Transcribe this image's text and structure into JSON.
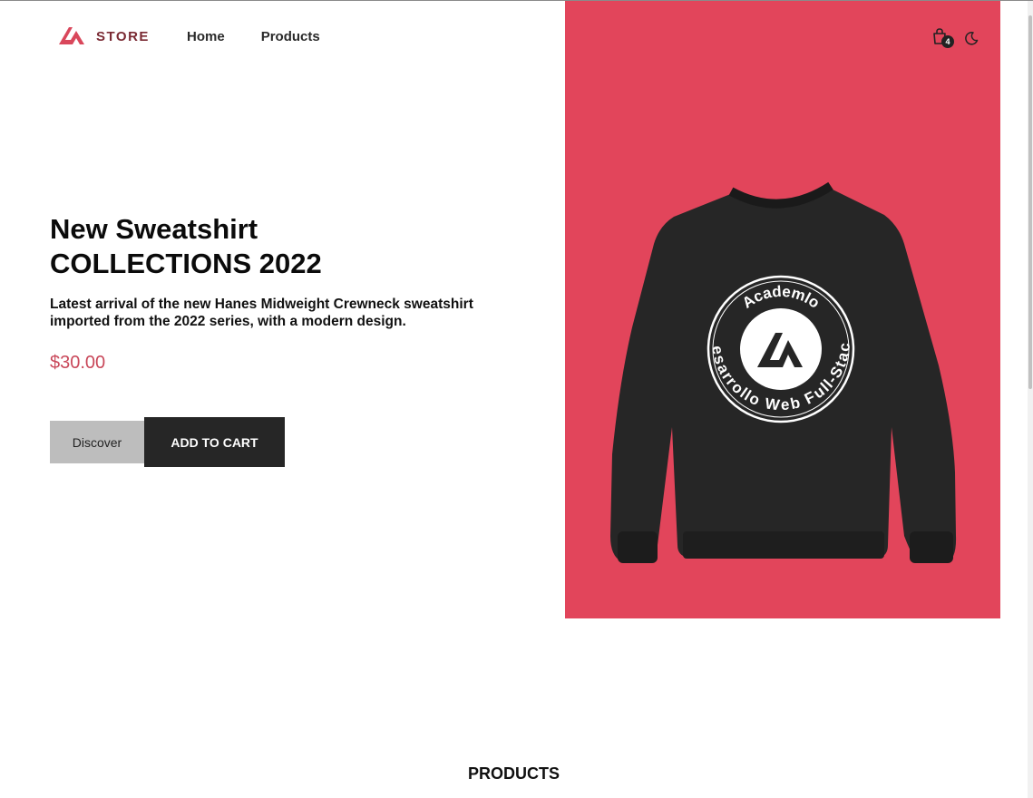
{
  "header": {
    "logo_text": "STORE",
    "nav": [
      {
        "label": "Home"
      },
      {
        "label": "Products"
      }
    ],
    "cart_count": "4",
    "icons": {
      "cart": "shopping-bag-icon",
      "theme": "moon-icon"
    }
  },
  "hero": {
    "title_line1": "New Sweatshirt",
    "title_line2": "COLLECTIONS 2022",
    "description": "Latest arrival of the new Hanes Midweight Crewneck sweatshirt imported from the 2022 series, with a modern design.",
    "price": "$30.00",
    "discover_label": "Discover",
    "add_to_cart_label": "ADD TO CART",
    "image": {
      "background_color": "#e2455b",
      "badge_top_text": "Academlo",
      "badge_bottom_text": "Desarrollo Web Full-Stack"
    }
  },
  "products_section": {
    "title": "PRODUCTS"
  },
  "colors": {
    "accent": "#e2455b",
    "price": "#c9485a",
    "logo_text": "#7a2a33",
    "dark_button": "#262626",
    "light_button": "#bdbdbd"
  }
}
